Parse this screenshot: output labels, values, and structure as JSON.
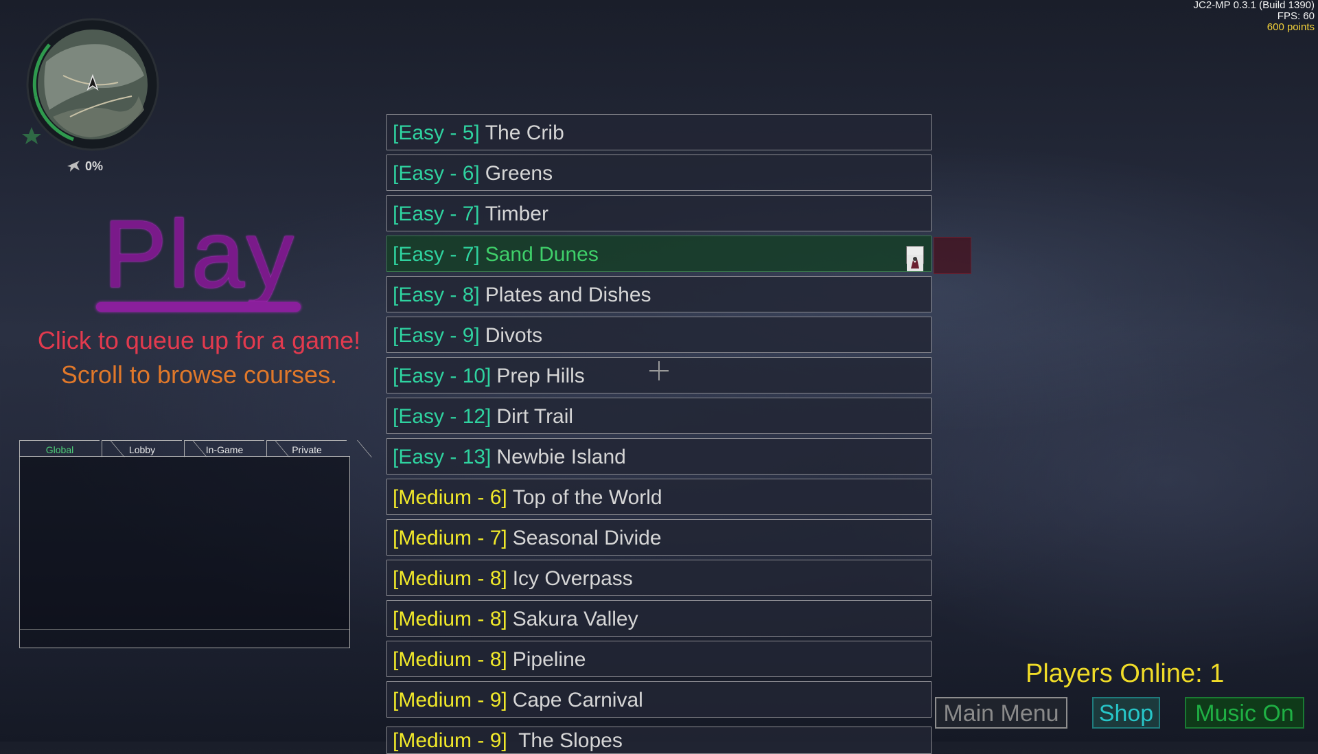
{
  "hud": {
    "version": "JC2-MP 0.3.1 (Build 1390)",
    "fps": "FPS: 60",
    "points": "600 points"
  },
  "minimap": {
    "percent": "0%"
  },
  "menu": {
    "title": "Play",
    "queue_hint": "Click to queue up for a game!",
    "scroll_hint": "Scroll to browse courses."
  },
  "chat": {
    "tabs": [
      "Global",
      "Lobby",
      "In-Game",
      "Private"
    ],
    "active_tab": "Global"
  },
  "courses": [
    {
      "tag": "[Easy - 5]",
      "difficulty": "easy",
      "name": "The Crib"
    },
    {
      "tag": "[Easy - 6]",
      "difficulty": "easy",
      "name": "Greens"
    },
    {
      "tag": "[Easy - 7]",
      "difficulty": "easy",
      "name": "Timber"
    },
    {
      "tag": "[Easy - 7]",
      "difficulty": "easy",
      "name": "Sand Dunes",
      "selected": true
    },
    {
      "tag": "[Easy - 8]",
      "difficulty": "easy",
      "name": "Plates and Dishes"
    },
    {
      "tag": "[Easy - 9]",
      "difficulty": "easy",
      "name": "Divots"
    },
    {
      "tag": "[Easy - 10]",
      "difficulty": "easy",
      "name": "Prep Hills"
    },
    {
      "tag": "[Easy - 12]",
      "difficulty": "easy",
      "name": "Dirt Trail"
    },
    {
      "tag": "[Easy - 13]",
      "difficulty": "easy",
      "name": "Newbie Island"
    },
    {
      "tag": "[Medium - 6]",
      "difficulty": "medium",
      "name": "Top of the World"
    },
    {
      "tag": "[Medium - 7]",
      "difficulty": "medium",
      "name": "Seasonal Divide"
    },
    {
      "tag": "[Medium - 8]",
      "difficulty": "medium",
      "name": "Icy Overpass"
    },
    {
      "tag": "[Medium - 8]",
      "difficulty": "medium",
      "name": "Sakura Valley"
    },
    {
      "tag": "[Medium - 8]",
      "difficulty": "medium",
      "name": "Pipeline"
    },
    {
      "tag": "[Medium - 9]",
      "difficulty": "medium",
      "name": "Cape Carnival"
    }
  ],
  "partial_course": {
    "tag": "[Medium - 9]",
    "name": "The Slopes"
  },
  "status": {
    "players_online": "Players Online: 1"
  },
  "buttons": {
    "main_menu": "Main Menu",
    "shop": "Shop",
    "music": "Music On"
  },
  "colors": {
    "easy": "#2fd3a0",
    "medium": "#f2ea2a",
    "selected_name": "#3fd06a",
    "play_title": "#7a1a8a",
    "points": "#f5d33a"
  }
}
